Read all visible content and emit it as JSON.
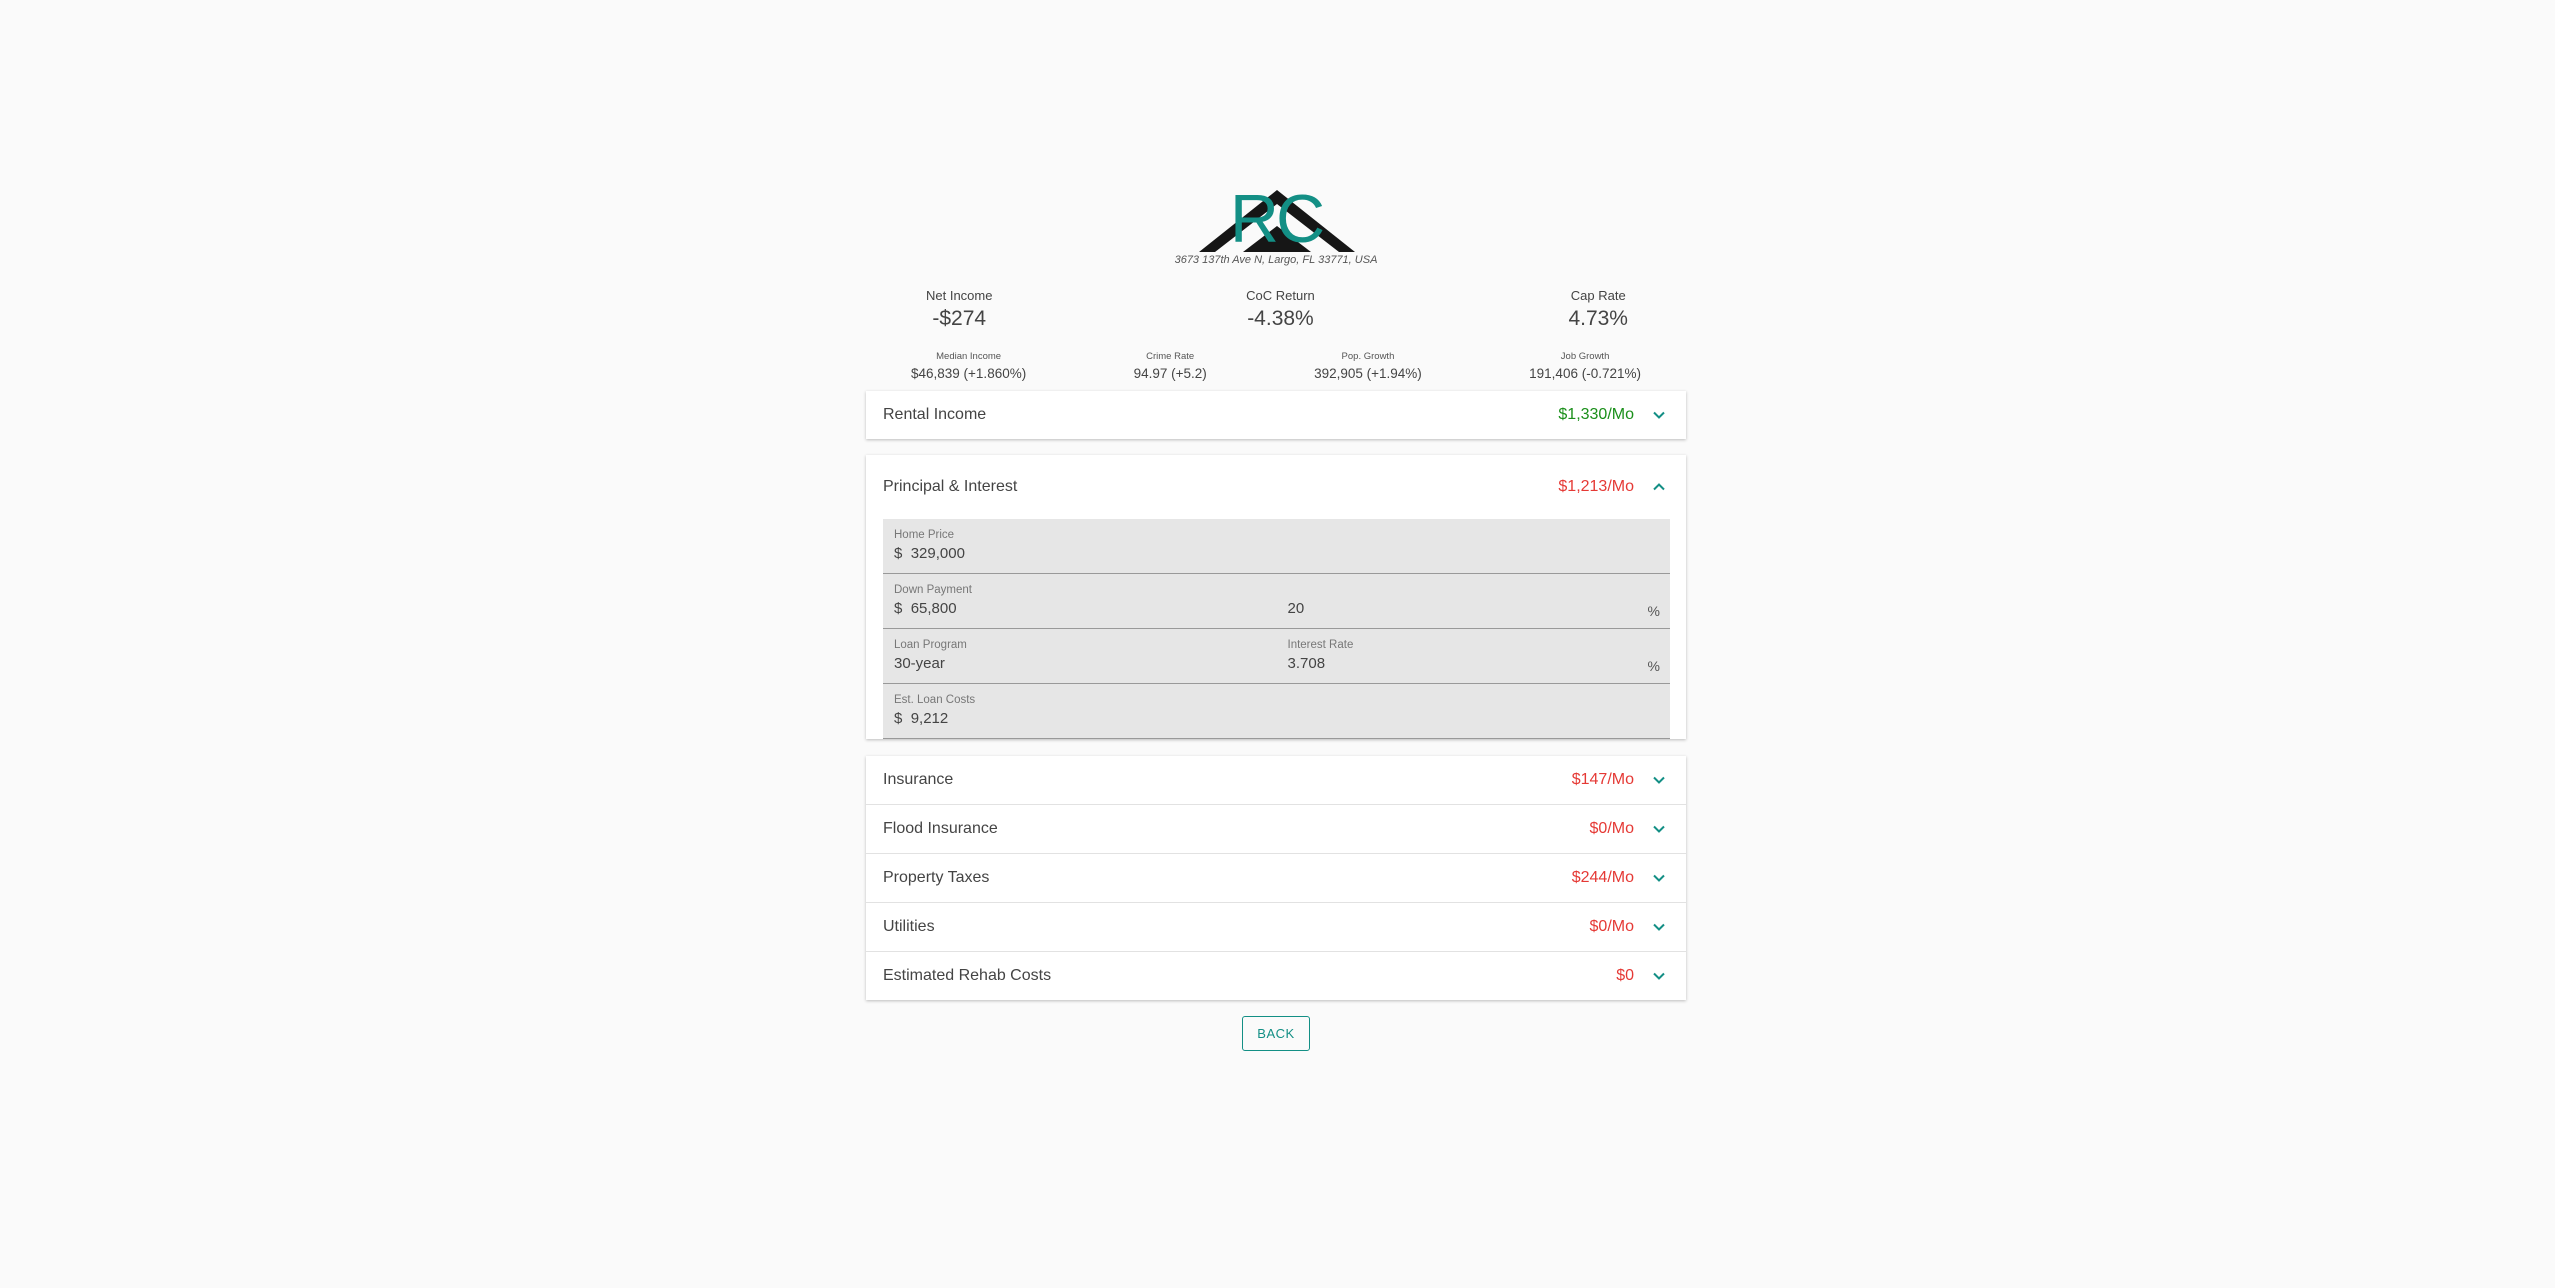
{
  "logo": {
    "text": "RC"
  },
  "address": "3673 137th Ave N, Largo, FL 33771, USA",
  "metrics": [
    {
      "label": "Net Income",
      "value": "-$274"
    },
    {
      "label": "CoC Return",
      "value": "-4.38%"
    },
    {
      "label": "Cap Rate",
      "value": "4.73%"
    }
  ],
  "stats": [
    {
      "label": "Median Income",
      "value": "$46,839 (+1.860%)"
    },
    {
      "label": "Crime Rate",
      "value": "94.97 (+5.2)"
    },
    {
      "label": "Pop. Growth",
      "value": "392,905 (+1.94%)"
    },
    {
      "label": "Job Growth",
      "value": "191,406 (-0.721%)"
    }
  ],
  "rental": {
    "title": "Rental Income",
    "amount": "$1,330/Mo"
  },
  "principal": {
    "title": "Principal & Interest",
    "amount": "$1,213/Mo",
    "home_price": {
      "label": "Home Price",
      "prefix": "$",
      "value": "329,000"
    },
    "down_payment": {
      "label": "Down Payment",
      "prefix": "$",
      "value": "65,800",
      "percent": "20",
      "percent_suffix": "%"
    },
    "loan_program": {
      "label": "Loan Program",
      "value": "30-year"
    },
    "interest_rate": {
      "label": "Interest Rate",
      "value": "3.708",
      "suffix": "%"
    },
    "loan_costs": {
      "label": "Est. Loan Costs",
      "prefix": "$",
      "value": "9,212"
    }
  },
  "expenses": [
    {
      "title": "Insurance",
      "amount": "$147/Mo"
    },
    {
      "title": "Flood Insurance",
      "amount": "$0/Mo"
    },
    {
      "title": "Property Taxes",
      "amount": "$244/Mo"
    },
    {
      "title": "Utilities",
      "amount": "$0/Mo"
    },
    {
      "title": "Estimated Rehab Costs",
      "amount": "$0"
    }
  ],
  "back_label": "BACK",
  "colors": {
    "accent": "#138f85",
    "positive": "#1a8f1a",
    "negative": "#e53935"
  }
}
